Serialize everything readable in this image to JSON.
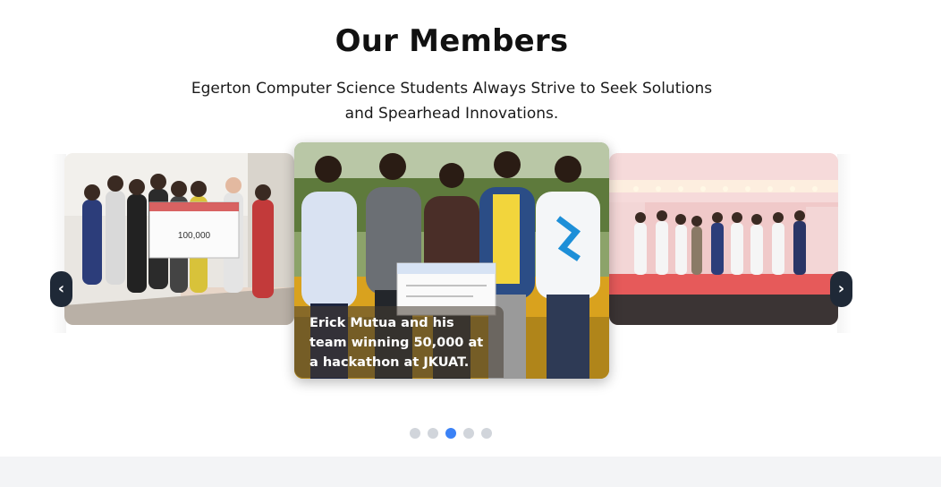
{
  "section": {
    "title": "Our Members",
    "subtitle": "Egerton Computer Science Students Always Strive to Seek Solutions and Spearhead Innovations."
  },
  "carousel": {
    "caption": "Erick Mutua and his team winning 50,000 at a hackathon at JKUAT.",
    "prev_icon": "chevron-left-icon",
    "next_icon": "chevron-right-icon",
    "nav_prev_glyph": "‹",
    "nav_next_glyph": "›",
    "slide_count": 5,
    "active_index": 2
  },
  "colors": {
    "nav_button_bg": "#1f2937",
    "dot_inactive": "#d1d5db",
    "dot_active": "#3b82f6",
    "footer_band": "#f3f4f6"
  }
}
